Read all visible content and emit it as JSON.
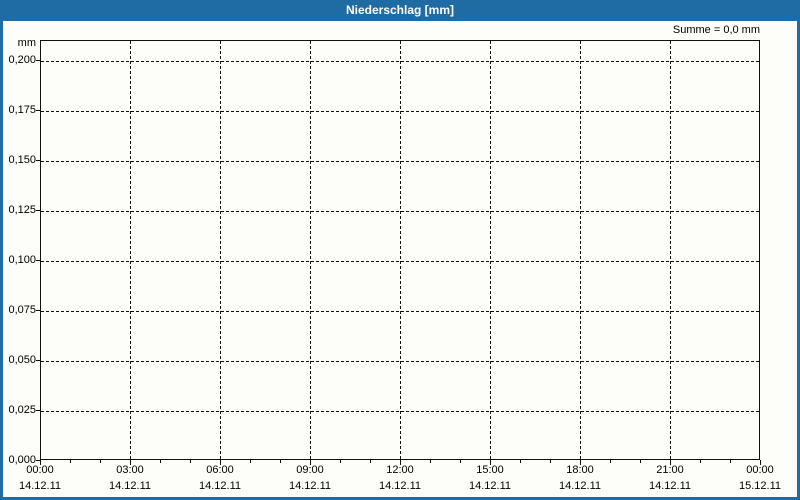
{
  "title_bar": {
    "title": "Niederschlag [mm]"
  },
  "summary": {
    "label": "Summe = 0,0 mm"
  },
  "colors": {
    "accent_blue": "#1e6ca3",
    "background": "#fdfdfa",
    "grid": "#111111",
    "text": "#000000"
  },
  "axes": {
    "y_unit_label": "mm",
    "y_tick_labels_top_to_bottom": [
      "0,200",
      "0,175",
      "0,150",
      "0,125",
      "0,100",
      "0,075",
      "0,050",
      "0,025",
      "0,000"
    ],
    "x_major_ticks": [
      {
        "time": "00:00",
        "date": "14.12.11"
      },
      {
        "time": "03:00",
        "date": "14.12.11"
      },
      {
        "time": "06:00",
        "date": "14.12.11"
      },
      {
        "time": "09:00",
        "date": "14.12.11"
      },
      {
        "time": "12:00",
        "date": "14.12.11"
      },
      {
        "time": "15:00",
        "date": "14.12.11"
      },
      {
        "time": "18:00",
        "date": "14.12.11"
      },
      {
        "time": "21:00",
        "date": "14.12.11"
      },
      {
        "time": "00:00",
        "date": "15.12.11"
      }
    ]
  },
  "chart_data": {
    "type": "bar",
    "title": "Niederschlag [mm]",
    "xlabel": "",
    "ylabel": "mm",
    "ylim": [
      0.0,
      0.2
    ],
    "ytick_interval": 0.025,
    "ytick_values": [
      0.0,
      0.025,
      0.05,
      0.075,
      0.1,
      0.125,
      0.15,
      0.175,
      0.2
    ],
    "ytick_labels": [
      "0,000",
      "0,025",
      "0,050",
      "0,075",
      "0,100",
      "0,125",
      "0,150",
      "0,175",
      "0,200"
    ],
    "categories": [
      "00:00",
      "03:00",
      "06:00",
      "09:00",
      "12:00",
      "15:00",
      "18:00",
      "21:00",
      "00:00"
    ],
    "category_dates": [
      "14.12.11",
      "14.12.11",
      "14.12.11",
      "14.12.11",
      "14.12.11",
      "14.12.11",
      "14.12.11",
      "14.12.11",
      "15.12.11"
    ],
    "x_minor_tick_interval_hours": 1,
    "x_major_tick_interval_hours": 3,
    "grid": true,
    "grid_style": "dashed",
    "legend": false,
    "annotation": "Summe = 0,0 mm",
    "series": [
      {
        "name": "Niederschlag",
        "values": [
          0,
          0,
          0,
          0,
          0,
          0,
          0,
          0,
          0
        ]
      }
    ],
    "sum_mm": 0.0
  }
}
